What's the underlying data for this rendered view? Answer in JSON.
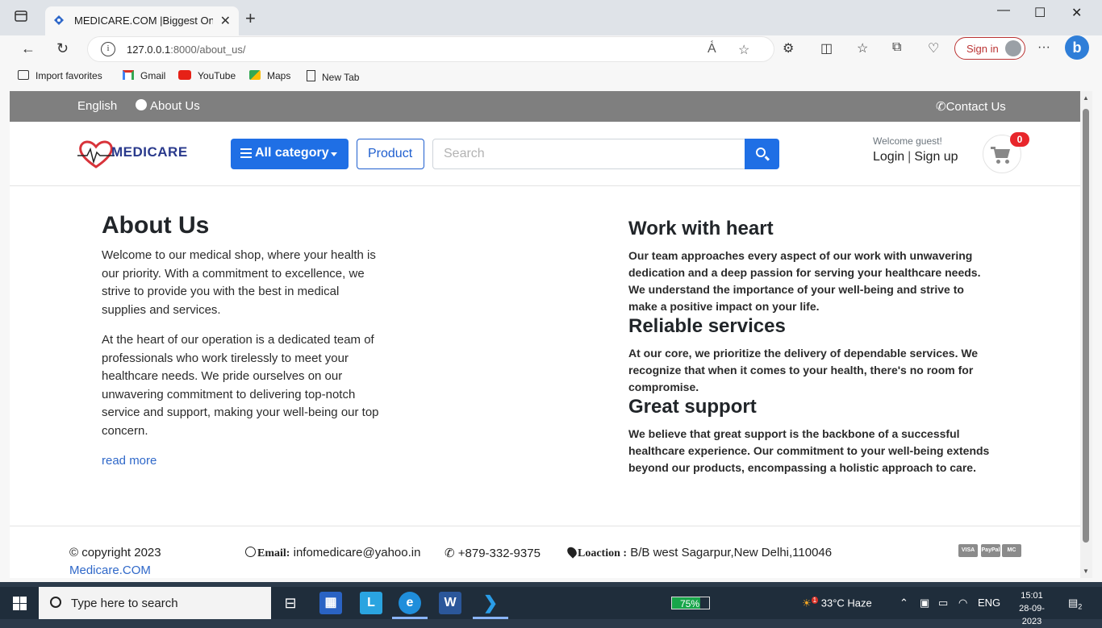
{
  "browser": {
    "tab_title": "MEDICARE.COM |Biggest Online",
    "url_host": "127.0.0.1",
    "url_rest": ":8000/about_us/",
    "sign_in": "Sign in",
    "favorites": [
      {
        "label": "Import favorites",
        "icon": "import-icon"
      },
      {
        "label": "Gmail",
        "icon": "gmail-icon"
      },
      {
        "label": "YouTube",
        "icon": "youtube-icon"
      },
      {
        "label": "Maps",
        "icon": "maps-icon"
      },
      {
        "label": "New Tab",
        "icon": "page-icon"
      }
    ]
  },
  "topbar": {
    "language": "English",
    "about": "About Us",
    "contact": "Contact Us"
  },
  "header": {
    "logo_text": "MEDICARE",
    "category_button": "All category",
    "product_button": "Product",
    "search_placeholder": "Search",
    "welcome": "Welcome guest!",
    "login": "Login",
    "separator": "|",
    "signup": "Sign up",
    "cart_count": "0"
  },
  "about": {
    "title": "About Us",
    "para1": "Welcome to our medical shop, where your health is our priority. With a commitment to excellence, we strive to provide you with the best in medical supplies and services.",
    "para2": "At the heart of our operation is a dedicated team of professionals who work tirelessly to meet your healthcare needs. We pride ourselves on our unwavering commitment to delivering top-notch service and support, making your well-being our top concern.",
    "read_more": "read more"
  },
  "features": [
    {
      "title": "Work with heart",
      "text": "Our team approaches every aspect of our work with unwavering dedication and a deep passion for serving your healthcare needs. We understand the importance of your well-being and strive to make a positive impact on your life."
    },
    {
      "title": "Reliable services",
      "text": "At our core, we prioritize the delivery of dependable services. We recognize that when it comes to your health, there's no room for compromise."
    },
    {
      "title": "Great support",
      "text": "We believe that great support is the backbone of a successful healthcare experience. Our commitment to your well-being extends beyond our products, encompassing a holistic approach to care."
    }
  ],
  "footer": {
    "copyright": "© copyright 2023",
    "brand": "Medicare.COM",
    "email_label": "Email:",
    "email": "infomedicare@yahoo.in",
    "phone": "+879-332-9375",
    "location_label": "Loaction :",
    "location": "B/B west Sagarpur,New Delhi,110046",
    "payments": [
      "VISA",
      "PayPal",
      "MC"
    ]
  },
  "taskbar": {
    "search_placeholder": "Type here to search",
    "battery": "75%",
    "weather": "33°C  Haze",
    "language": "ENG",
    "time": "15:01",
    "date": "28-09-2023",
    "notifications": "2",
    "weather_badge": "1"
  },
  "colors": {
    "primary": "#1f6fe5",
    "topbar": "#7f7f7f",
    "badge": "#e8262b",
    "link": "#2f68c9"
  }
}
